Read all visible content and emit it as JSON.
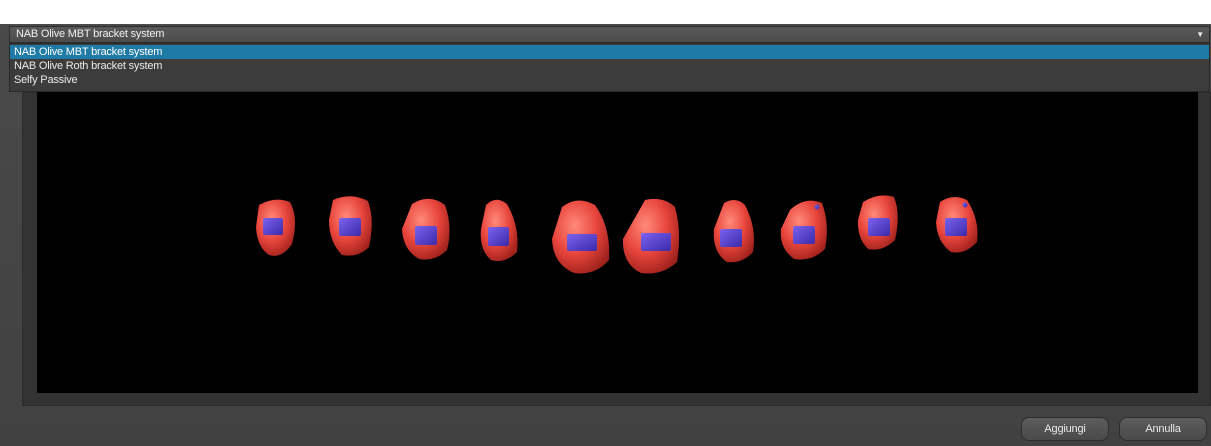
{
  "bracket_select": {
    "value": "NAB Olive MBT bracket system",
    "options": [
      "NAB Olive MBT bracket system",
      "NAB Olive Roth bracket system",
      "Selfy Passive"
    ],
    "selected_index": 0
  },
  "buttons": {
    "add_label": "Aggiungi",
    "cancel_label": "Annulla"
  },
  "colors": {
    "tooth": "#e8453c",
    "bracket": "#5a3fd6",
    "highlight": "#1f7aa6",
    "viewport_bg": "#000000"
  },
  "teeth_count": 10
}
